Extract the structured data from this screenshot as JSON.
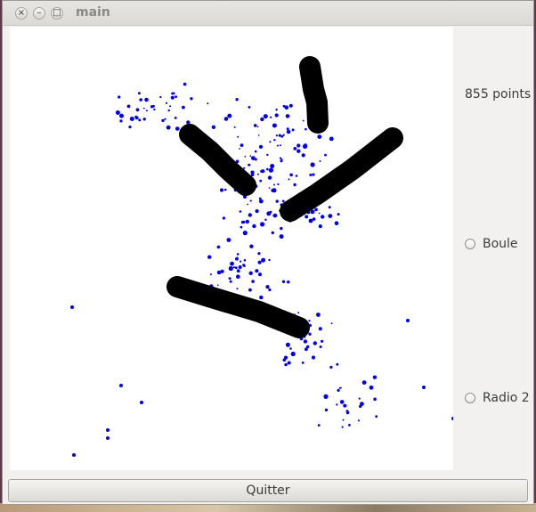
{
  "window": {
    "title": "main",
    "close_glyph": "×",
    "minimize_glyph": "–",
    "maximize_glyph": "□"
  },
  "sidebar": {
    "points_label": "855 points",
    "radios": [
      {
        "label": "Boule",
        "checked": false
      },
      {
        "label": "Radio 2",
        "checked": false
      }
    ]
  },
  "footer": {
    "quit_label": "Quitter"
  },
  "colors": {
    "point": "#0000ee",
    "stroke": "#000000",
    "canvas": "#ffffff"
  }
}
